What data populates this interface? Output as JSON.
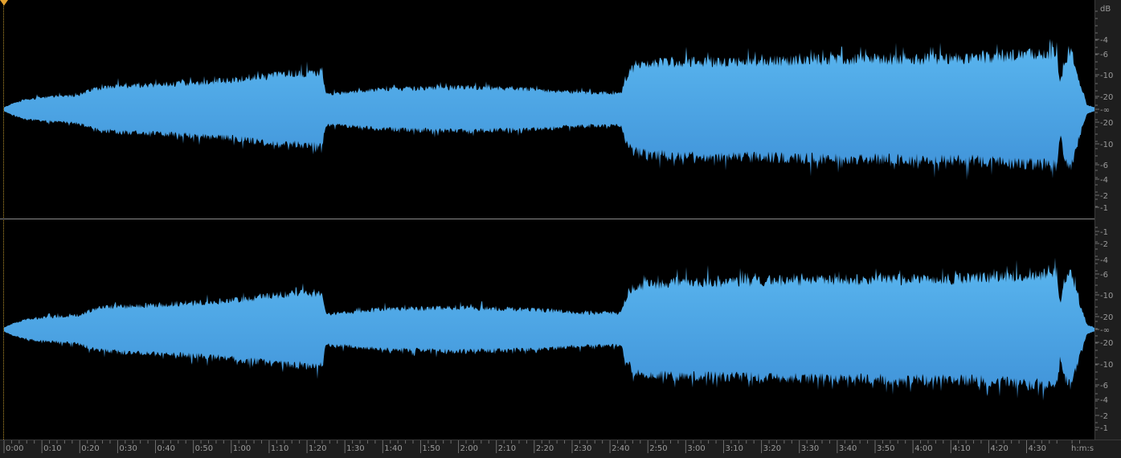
{
  "colors": {
    "background": "#000000",
    "waveform_top": "#5ab6ef",
    "waveform_bottom": "#3f92d8",
    "ruler_bg": "#1e1e1e",
    "ruler_text": "#9a9a9a",
    "playhead": "#e4a230",
    "divider": "#8a8a8a"
  },
  "playhead": {
    "icon": "playhead-triangle-icon",
    "time_seconds": 0
  },
  "db_ruler": {
    "unit_label": "dB",
    "channels": [
      {
        "name": "top",
        "ticks": [
          "-4",
          "-6",
          "-10",
          "-20",
          "-∞",
          "-20",
          "-10",
          "-6",
          "-4",
          "-2",
          "-1"
        ]
      },
      {
        "name": "bottom",
        "ticks": [
          "-1",
          "-2",
          "-4",
          "-6",
          "-10",
          "-20",
          "-∞",
          "-20",
          "-10",
          "-6",
          "-4",
          "-2",
          "-1"
        ]
      }
    ]
  },
  "time_ruler": {
    "unit_label": "h:m:s",
    "labels": [
      "0:00",
      "0:10",
      "0:20",
      "0:30",
      "0:40",
      "0:50",
      "1:00",
      "1:10",
      "1:20",
      "1:30",
      "1:40",
      "1:50",
      "2:00",
      "2:10",
      "2:20",
      "2:30",
      "2:40",
      "2:50",
      "3:00",
      "3:10",
      "3:20",
      "3:30",
      "3:40",
      "3:50",
      "4:00",
      "4:10",
      "4:20",
      "4:30"
    ]
  },
  "waveform": {
    "channel_count": 2,
    "duration_seconds": 288,
    "envelope": [
      [
        0,
        0.02
      ],
      [
        2,
        0.06
      ],
      [
        5,
        0.1
      ],
      [
        10,
        0.13
      ],
      [
        15,
        0.14
      ],
      [
        20,
        0.16
      ],
      [
        24,
        0.23
      ],
      [
        30,
        0.25
      ],
      [
        40,
        0.27
      ],
      [
        50,
        0.29
      ],
      [
        60,
        0.32
      ],
      [
        70,
        0.37
      ],
      [
        80,
        0.4
      ],
      [
        84,
        0.4
      ],
      [
        85,
        0.17
      ],
      [
        90,
        0.18
      ],
      [
        100,
        0.22
      ],
      [
        110,
        0.23
      ],
      [
        120,
        0.24
      ],
      [
        130,
        0.23
      ],
      [
        140,
        0.22
      ],
      [
        150,
        0.19
      ],
      [
        155,
        0.18
      ],
      [
        163,
        0.18
      ],
      [
        164,
        0.33
      ],
      [
        166,
        0.45
      ],
      [
        170,
        0.5
      ],
      [
        180,
        0.52
      ],
      [
        200,
        0.53
      ],
      [
        220,
        0.55
      ],
      [
        240,
        0.55
      ],
      [
        260,
        0.57
      ],
      [
        270,
        0.6
      ],
      [
        278,
        0.62
      ],
      [
        279,
        0.25
      ],
      [
        280,
        0.55
      ],
      [
        282,
        0.62
      ],
      [
        284,
        0.3
      ],
      [
        286,
        0.05
      ],
      [
        288,
        0.02
      ]
    ]
  }
}
